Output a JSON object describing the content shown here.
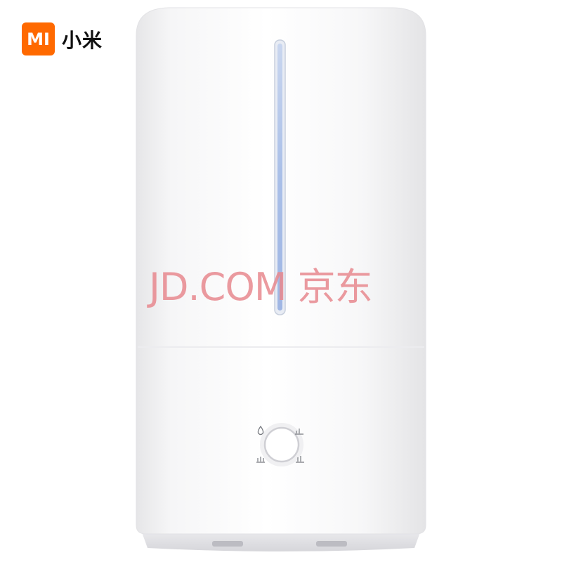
{
  "brand": {
    "mark_text": "MI",
    "name": "小米",
    "color": "#ff6900"
  },
  "watermark": {
    "text": "JD.COM 京东",
    "color": "#e8898f"
  },
  "product": {
    "icons": [
      "water-drop-icon",
      "humidity-level-icon",
      "humidity-level-icon",
      "humidity-level-icon"
    ],
    "light_strip_color": "#a9bfe8"
  }
}
